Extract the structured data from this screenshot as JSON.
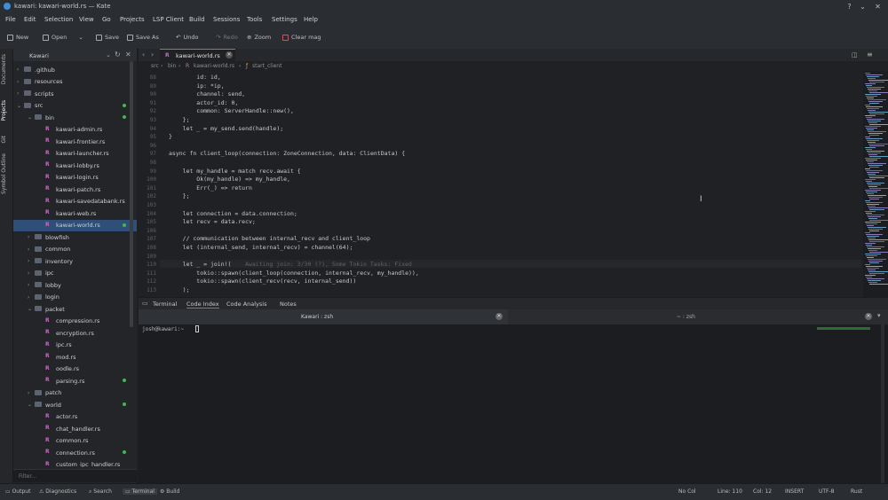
{
  "window": {
    "title": "kawari: kawari-world.rs — Kate"
  },
  "menu": [
    "File",
    "Edit",
    "Selection",
    "View",
    "Go",
    "Projects",
    "LSP Client",
    "Build",
    "Sessions",
    "Tools",
    "Settings",
    "Help"
  ],
  "toolbar": {
    "new_label": "New",
    "open_label": "Open",
    "save_label": "Save",
    "save_as_label": "Save As",
    "undo_label": "Undo",
    "redo_label": "Redo",
    "zoom_label": "Zoom",
    "clear_label": "Clear mag"
  },
  "side_tabs": [
    "Documents",
    "Projects",
    "Git",
    "Symbol Outline"
  ],
  "project": {
    "name": "Kawari",
    "filter_placeholder": "Filter...",
    "tree": [
      {
        "label": ".github",
        "type": "folder",
        "depth": 0,
        "expanded": false,
        "dot": false
      },
      {
        "label": "resources",
        "type": "folder",
        "depth": 0,
        "expanded": false,
        "dot": false
      },
      {
        "label": "scripts",
        "type": "folder",
        "depth": 0,
        "expanded": false,
        "dot": false
      },
      {
        "label": "src",
        "type": "folder",
        "depth": 0,
        "expanded": true,
        "dot": true
      },
      {
        "label": "bin",
        "type": "folder",
        "depth": 1,
        "expanded": true,
        "dot": true
      },
      {
        "label": "kawari-admin.rs",
        "type": "rs",
        "depth": 2,
        "dot": false
      },
      {
        "label": "kawari-frontier.rs",
        "type": "rs",
        "depth": 2,
        "dot": false
      },
      {
        "label": "kawari-launcher.rs",
        "type": "rs",
        "depth": 2,
        "dot": false
      },
      {
        "label": "kawari-lobby.rs",
        "type": "rs",
        "depth": 2,
        "dot": false
      },
      {
        "label": "kawari-login.rs",
        "type": "rs",
        "depth": 2,
        "dot": false
      },
      {
        "label": "kawari-patch.rs",
        "type": "rs",
        "depth": 2,
        "dot": false
      },
      {
        "label": "kawari-savedatabank.rs",
        "type": "rs",
        "depth": 2,
        "dot": false
      },
      {
        "label": "kawari-web.rs",
        "type": "rs",
        "depth": 2,
        "dot": false
      },
      {
        "label": "kawari-world.rs",
        "type": "rs",
        "depth": 2,
        "dot": true,
        "selected": true
      },
      {
        "label": "blowfish",
        "type": "folder",
        "depth": 1,
        "expanded": false,
        "dot": false
      },
      {
        "label": "common",
        "type": "folder",
        "depth": 1,
        "expanded": false,
        "dot": false
      },
      {
        "label": "inventory",
        "type": "folder",
        "depth": 1,
        "expanded": false,
        "dot": false
      },
      {
        "label": "ipc",
        "type": "folder",
        "depth": 1,
        "expanded": false,
        "dot": false
      },
      {
        "label": "lobby",
        "type": "folder",
        "depth": 1,
        "expanded": false,
        "dot": false
      },
      {
        "label": "login",
        "type": "folder",
        "depth": 1,
        "expanded": false,
        "dot": false
      },
      {
        "label": "packet",
        "type": "folder",
        "depth": 1,
        "expanded": true,
        "dot": false
      },
      {
        "label": "compression.rs",
        "type": "rs",
        "depth": 2,
        "dot": false
      },
      {
        "label": "encryption.rs",
        "type": "rs",
        "depth": 2,
        "dot": false
      },
      {
        "label": "ipc.rs",
        "type": "rs",
        "depth": 2,
        "dot": false
      },
      {
        "label": "mod.rs",
        "type": "rs",
        "depth": 2,
        "dot": false
      },
      {
        "label": "oodle.rs",
        "type": "rs",
        "depth": 2,
        "dot": false
      },
      {
        "label": "parsing.rs",
        "type": "rs",
        "depth": 2,
        "dot": true
      },
      {
        "label": "patch",
        "type": "folder",
        "depth": 1,
        "expanded": false,
        "dot": false
      },
      {
        "label": "world",
        "type": "folder",
        "depth": 1,
        "expanded": true,
        "dot": true
      },
      {
        "label": "actor.rs",
        "type": "rs",
        "depth": 2,
        "dot": false
      },
      {
        "label": "chat_handler.rs",
        "type": "rs",
        "depth": 2,
        "dot": false
      },
      {
        "label": "common.rs",
        "type": "rs",
        "depth": 2,
        "dot": false
      },
      {
        "label": "connection.rs",
        "type": "rs",
        "depth": 2,
        "dot": true
      },
      {
        "label": "custom_ipc_handler.rs",
        "type": "rs",
        "depth": 2,
        "dot": false
      }
    ]
  },
  "editor": {
    "tab_label": "kawari-world.rs",
    "breadcrumb": [
      "src",
      "bin",
      "kawari-world.rs",
      "start_client"
    ],
    "lines": [
      {
        "num": "88",
        "text": "        id: id,"
      },
      {
        "num": "89",
        "text": "        ip: *ip,"
      },
      {
        "num": "90",
        "text": "        channel: send,"
      },
      {
        "num": "91",
        "text": "        actor_id: 0,"
      },
      {
        "num": "92",
        "text": "        common: ServerHandle::new(),"
      },
      {
        "num": "93",
        "text": "    };"
      },
      {
        "num": "94",
        "text": "    let _ = my_send.send(handle);"
      },
      {
        "num": "95",
        "text": "}"
      },
      {
        "num": "96",
        "text": ""
      },
      {
        "num": "97",
        "text": "async fn client_loop(connection: ZoneConnection, data: ClientData) {"
      },
      {
        "num": "98",
        "text": ""
      },
      {
        "num": "99",
        "text": "    let my_handle = match recv.await {"
      },
      {
        "num": "100",
        "text": "        Ok(my_handle) => my_handle,"
      },
      {
        "num": "101",
        "text": "        Err(_) => return"
      },
      {
        "num": "102",
        "text": "    };"
      },
      {
        "num": "103",
        "text": ""
      },
      {
        "num": "104",
        "text": "    let connection = data.connection;"
      },
      {
        "num": "105",
        "text": "    let recv = data.recv;"
      },
      {
        "num": "106",
        "text": ""
      },
      {
        "num": "107",
        "text": "    // communication between internal_recv and client_loop"
      },
      {
        "num": "108",
        "text": "    let (internal_send, internal_recv) = channel(64);"
      },
      {
        "num": "109",
        "text": ""
      },
      {
        "num": "110",
        "text": "    let _ = join!("
      },
      {
        "num": "111",
        "text": "        tokio::spawn(client_loop(connection, internal_recv, my_handle)),"
      },
      {
        "num": "112",
        "text": "        tokio::spawn(client_recv(recv, internal_send))"
      },
      {
        "num": "113",
        "text": "    );"
      }
    ],
    "inline_hint": "Awaiting join: 3/30 (?), Some Tokio Tasks: Fixed"
  },
  "bottom_tabs": [
    "Terminal",
    "Code Index",
    "Code Analysis",
    "Notes"
  ],
  "terminal": {
    "title": "Kawari : zsh",
    "second_tab": "~ : zsh",
    "prompt": "josh@kawari:~"
  },
  "statusbar": {
    "left": [
      "Output",
      "Diagnostics",
      "Search",
      "Terminal",
      "Build"
    ],
    "right": [
      "No Col",
      "Line: 110",
      "Col: 12",
      "INSERT",
      "UTF-8",
      "Rust"
    ]
  },
  "colors": {
    "accent": "#3d8fd9",
    "selection": "#2f4e78",
    "git_dot": "#3fb950",
    "rs_icon": "#c56cc0"
  }
}
